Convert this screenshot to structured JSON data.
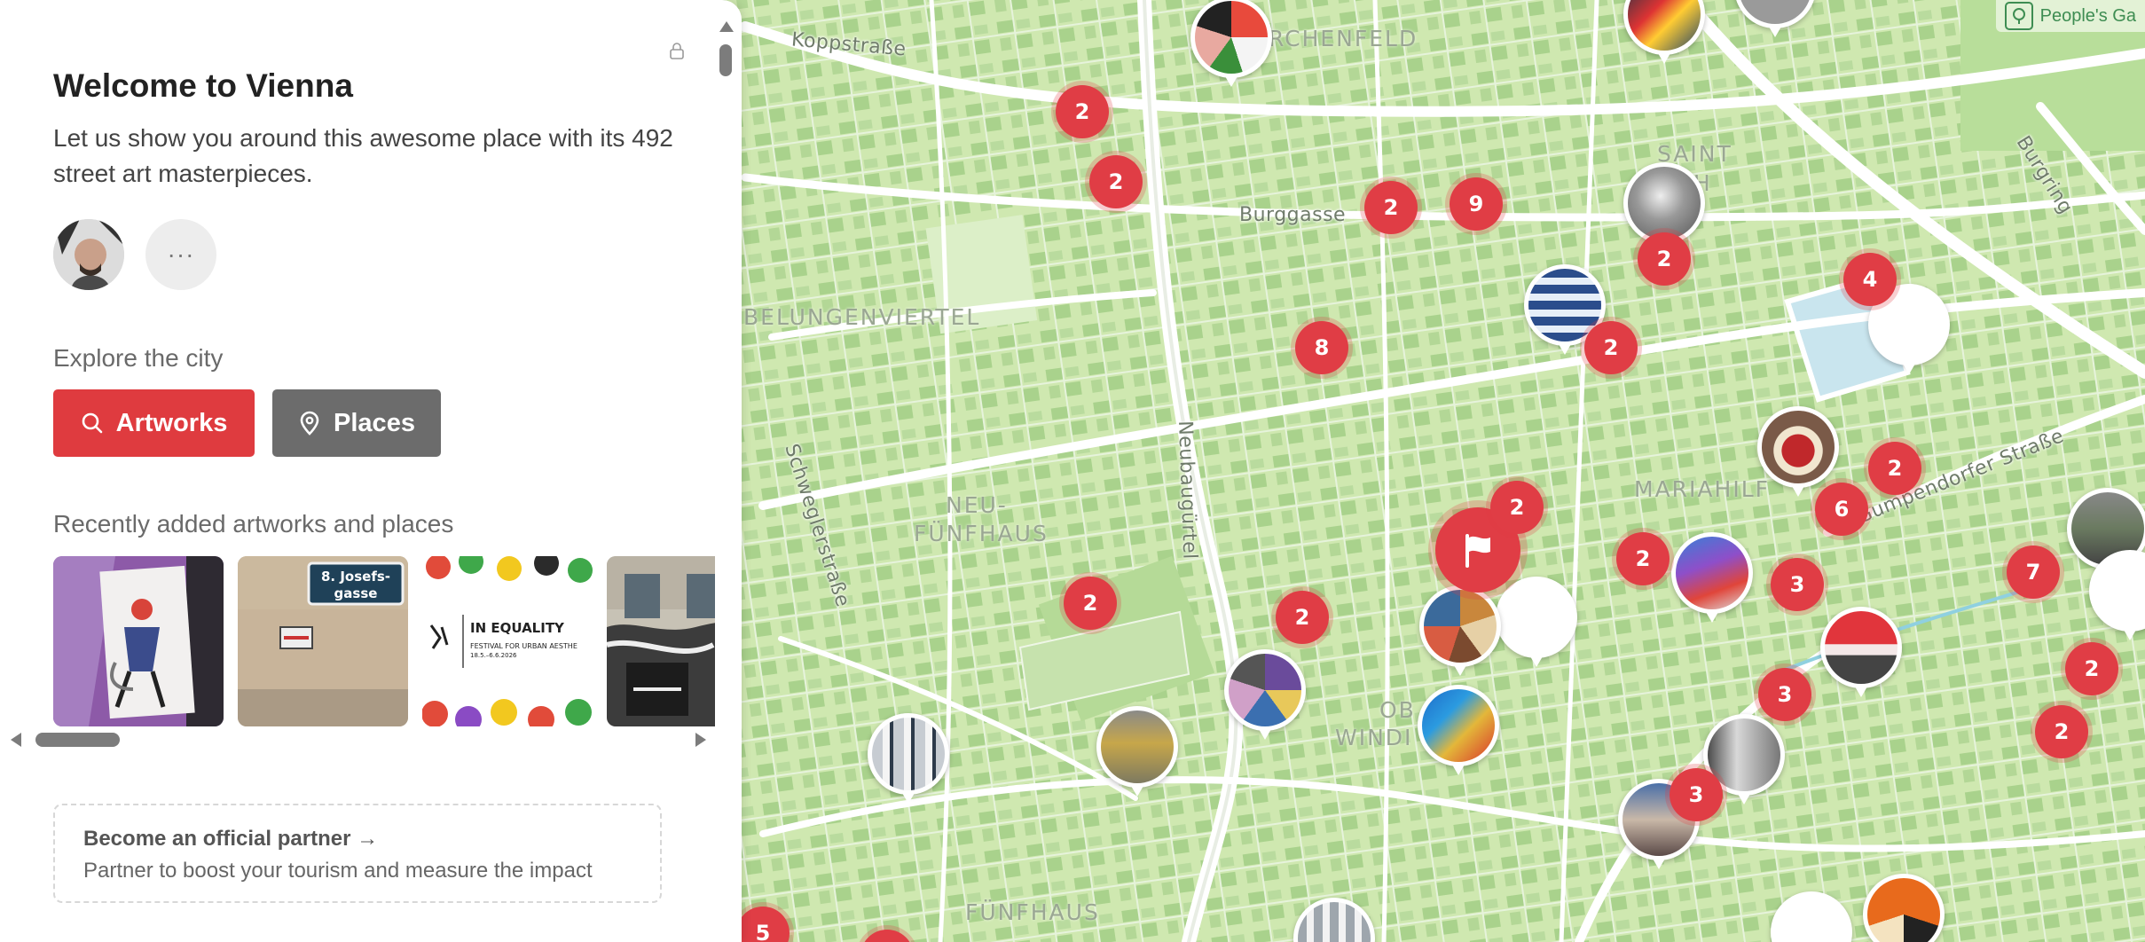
{
  "panel": {
    "title": "Welcome to Vienna",
    "intro": "Let us show you around this awesome place with its 492 street art masterpieces.",
    "more_label": "···",
    "explore_title": "Explore the city",
    "buttons": {
      "artworks": "Artworks",
      "places": "Places"
    },
    "recent_title": "Recently added artworks and places",
    "partner": {
      "title": "Become an official partner →",
      "subtitle": "Partner to boost your tourism and measure the impact"
    },
    "thumbnail_texts": {
      "sign_line1": "8. Josefs-",
      "sign_line2": "gasse",
      "poster_title": "IN EQUALITY",
      "poster_sub": "FESTIVAL FOR URBAN AESTHE",
      "poster_dates": "18.5.–6.6.2026"
    }
  },
  "map": {
    "badge": "People's Ga",
    "streets": [
      "Koppstraße",
      "Burggasse",
      "Schweglerstraße",
      "Neubaugürtel",
      "Gumpendorfer Straße",
      "Burgring"
    ],
    "districts": [
      "RCHENFELD",
      "SAINT",
      "ICH",
      "BELUNGENVIERTEL",
      "NEU-",
      "FÜNFHAUS",
      "MARIAHILF",
      "OB",
      "WINDI",
      "FÜNFHAUS"
    ],
    "clusters": [
      "2",
      "2",
      "2",
      "9",
      "2",
      "4",
      "8",
      "2",
      "2",
      "2",
      "6",
      "2",
      "2",
      "2",
      "3",
      "7",
      "2",
      "3",
      "2",
      "3",
      "5"
    ],
    "colors": {
      "accent": "#df3b3f",
      "map_bg": "#cfe8b0"
    }
  }
}
